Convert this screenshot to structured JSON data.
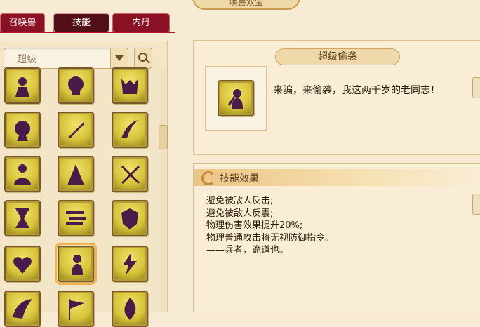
{
  "window": {
    "title": "唤兽双宝"
  },
  "tabs": [
    {
      "label": "召唤兽",
      "active": false
    },
    {
      "label": "技能",
      "active": true
    },
    {
      "label": "内丹",
      "active": false
    }
  ],
  "filter": {
    "selected": "超级"
  },
  "skill_grid": [
    [
      "hand-orb-icon",
      "skull-icon",
      "demon-icon"
    ],
    [
      "spiral-head-icon",
      "sword-icon",
      "claw-slash-icon"
    ],
    [
      "silhouette-icon",
      "hooded-figure-icon",
      "crossed-blades-icon"
    ],
    [
      "hourglass-icon",
      "speed-lines-icon",
      "shield-slash-icon"
    ],
    [
      "heart-icon",
      "sneak-attack-icon",
      "lightning-icon"
    ],
    [
      "wing-icon",
      "flag-icon",
      "flame-icon"
    ]
  ],
  "selected_skill": {
    "name": "超级偷袭",
    "icon": "sneak-attack-icon",
    "description": "来骗，来偷袭，我这两千岁的老同志！"
  },
  "effect": {
    "title": "技能效果",
    "lines": [
      "避免被敌人反击;",
      "避免被敌人反震;",
      "物理伤害效果提升20%;",
      "物理普通攻击将无视防御指令。",
      "——兵者，诡道也。"
    ]
  },
  "colors": {
    "tab_red": "#8a1024",
    "tab_active": "#511018",
    "panel_bg": "#f9edd5",
    "icon_gold": "#d7c43a",
    "icon_glyph": "#4a1a4a"
  }
}
